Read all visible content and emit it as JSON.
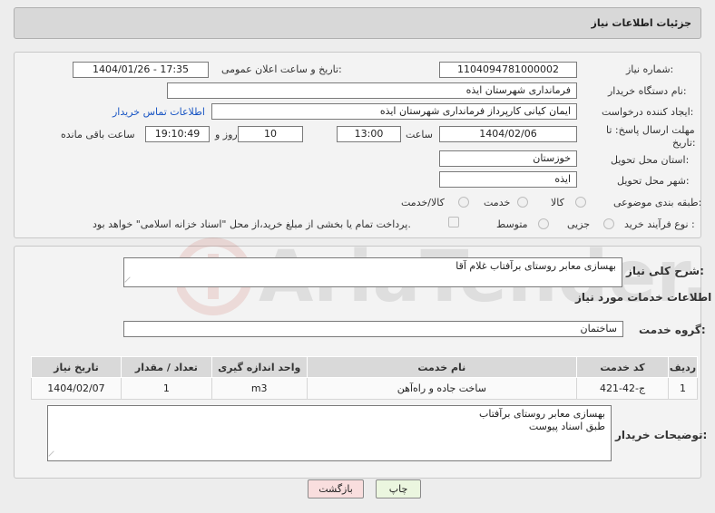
{
  "header": {
    "title": "جزئیات اطلاعات نیاز"
  },
  "form": {
    "need_number_label": "شماره نیاز:",
    "need_number": "1104094781000002",
    "announce_label": "تاریخ و ساعت اعلان عمومی:",
    "announce_value": "1404/01/26 - 17:35",
    "buyer_org_label": "نام دستگاه خریدار:",
    "buyer_org": "فرمانداری شهرستان ایذه",
    "creator_label": "ایجاد کننده درخواست:",
    "creator": "ایمان کیانی کارپرداز فرمانداری شهرستان ایذه",
    "contact_link": "اطلاعات تماس خریدار",
    "deadline_label_line1": "مهلت ارسال پاسخ: تا",
    "deadline_label_line2": "تاریخ:",
    "deadline_date": "1404/02/06",
    "time_label": "ساعت",
    "deadline_time": "13:00",
    "days_value": "10",
    "days_label": "روز و",
    "remaining_time": "19:10:49",
    "remaining_label": "ساعت باقی مانده",
    "province_label": "استان محل تحویل:",
    "province": "خوزستان",
    "city_label": "شهر محل تحویل:",
    "city": "ایذه",
    "category_label": "طبقه بندی موضوعی:",
    "category_options": [
      "کالا",
      "خدمت",
      "کالا/خدمت"
    ],
    "purchase_type_label": "نوع فرآیند خرید :",
    "purchase_type_options": [
      "جزیی",
      "متوسط"
    ],
    "payment_note": "پرداخت تمام یا بخشی از مبلغ خرید،از محل \"اسناد خزانه اسلامی\" خواهد بود."
  },
  "details": {
    "summary_label": "شرح کلی نیاز:",
    "summary": "بهسازی معابر روستای برآفتاب غلام آقا",
    "services_title": "اطلاعات خدمات مورد نیاز",
    "service_group_label": "گروه خدمت:",
    "service_group": "ساختمان"
  },
  "table": {
    "headers": [
      "ردیف",
      "کد خدمت",
      "نام خدمت",
      "واحد اندازه گیری",
      "تعداد / مقدار",
      "تاریخ نیاز"
    ],
    "rows": [
      [
        "1",
        "ج-42-421",
        "ساخت جاده و راه‌آهن",
        "m3",
        "1",
        "1404/02/07"
      ]
    ]
  },
  "buyer_notes": {
    "label": "توضیحات خریدار:",
    "line1": "بهسازی معابر روستای برآفتاب",
    "line2": "طبق اسناد پیوست"
  },
  "buttons": {
    "print": "چاپ",
    "back": "بازگشت"
  },
  "watermark_text": "AriaTender.neT"
}
